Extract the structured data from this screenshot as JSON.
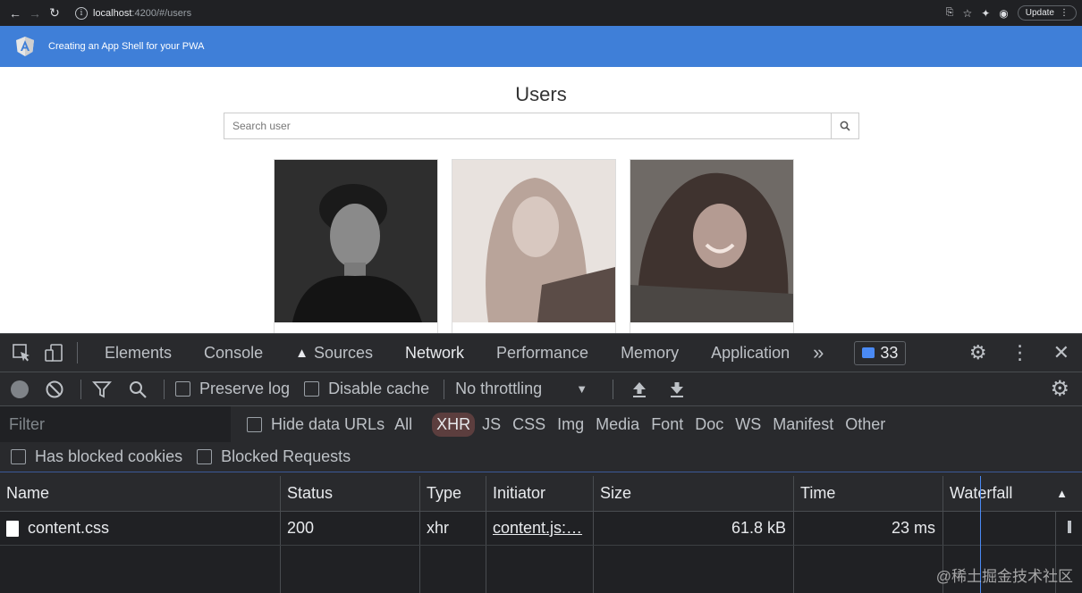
{
  "browser": {
    "url_host": "localhost",
    "url_path": ":4200/#/users",
    "update_label": "Update"
  },
  "app": {
    "toolbar_title": "Creating an App Shell for your PWA",
    "heading": "Users",
    "search_placeholder": "Search user"
  },
  "devtools": {
    "tabs": [
      "Elements",
      "Console",
      "Sources",
      "Network",
      "Performance",
      "Memory",
      "Application"
    ],
    "more": "»",
    "message_count": "33",
    "preserve_log": "Preserve log",
    "disable_cache": "Disable cache",
    "throttling": "No throttling",
    "filter_placeholder": "Filter",
    "hide_data_urls": "Hide data URLs",
    "types": [
      "All",
      "XHR",
      "JS",
      "CSS",
      "Img",
      "Media",
      "Font",
      "Doc",
      "WS",
      "Manifest",
      "Other"
    ],
    "selected_type": "XHR",
    "has_blocked_cookies": "Has blocked cookies",
    "blocked_requests": "Blocked Requests",
    "columns": {
      "name": "Name",
      "status": "Status",
      "type": "Type",
      "initiator": "Initiator",
      "size": "Size",
      "time": "Time",
      "waterfall": "Waterfall"
    },
    "rows": [
      {
        "name": "content.css",
        "status": "200",
        "type": "xhr",
        "initiator": "content.js:…",
        "size": "61.8 kB",
        "time": "23 ms"
      }
    ]
  },
  "watermark": "@稀土掘金技术社区",
  "colors": {
    "toolbar": "#3f7fd8",
    "devtools_bg": "#292a2d",
    "selected_filter": "#5c3e3e"
  }
}
